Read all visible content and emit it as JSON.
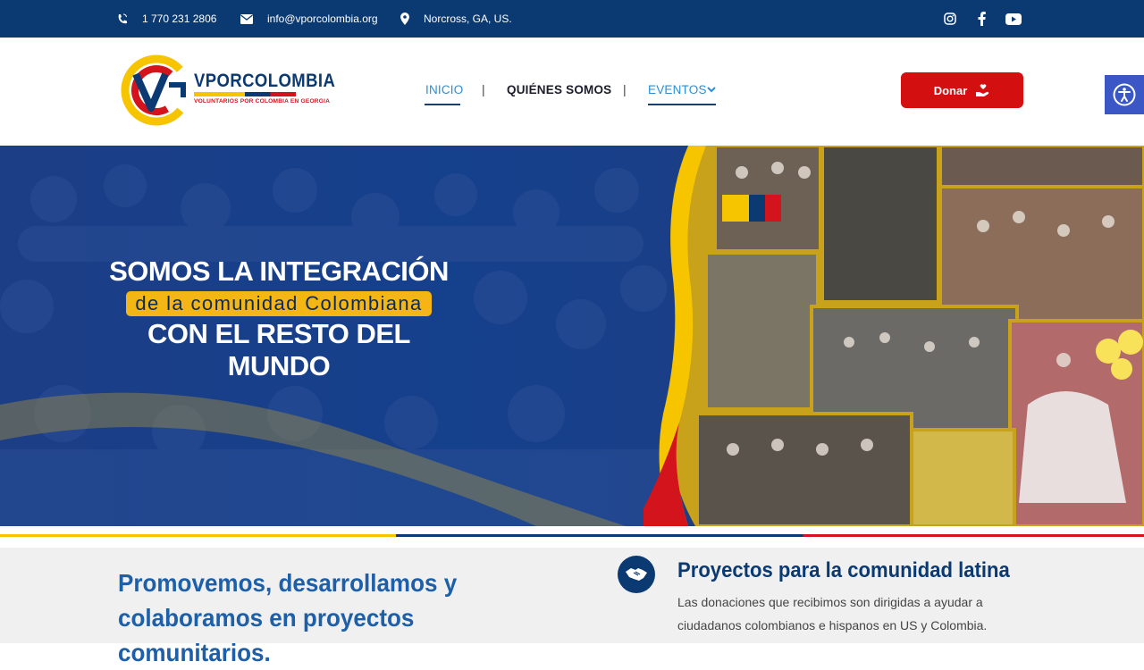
{
  "topbar": {
    "phone": "1 770 231 2806",
    "email": "info@vporcolombia.org",
    "location": "Norcross, GA, US.",
    "social": [
      "instagram-icon",
      "facebook-icon",
      "youtube-icon"
    ]
  },
  "header": {
    "logo_title": "VPORCOLOMBIA",
    "logo_subtitle": "VOLUNTARIOS POR COLOMBIA EN GEORGIA",
    "nav": {
      "inicio": "INICIO",
      "quienes": "QUIÉNES SOMOS",
      "eventos": "EVENTOS",
      "separator": "|"
    },
    "donate_label": "Donar"
  },
  "hero": {
    "line1": "SOMOS LA INTEGRACIÓN",
    "line2": "de la comunidad Colombiana",
    "line3": "CON EL RESTO DEL MUNDO"
  },
  "section": {
    "promo": "Promovemos, desarrollamos y colaboramos en proyectos comunitarios.",
    "projects_title": "Proyectos para la comunidad latina",
    "projects_desc": "Las donaciones que recibimos son dirigidas a ayudar a ciudadanos colombianos e hispanos en US y Colombia."
  },
  "colors": {
    "navy": "#0b3a73",
    "yellow": "#f7c500",
    "red": "#d4141c",
    "link_blue": "#2a8fd6",
    "donate_red": "#d40f0f"
  }
}
